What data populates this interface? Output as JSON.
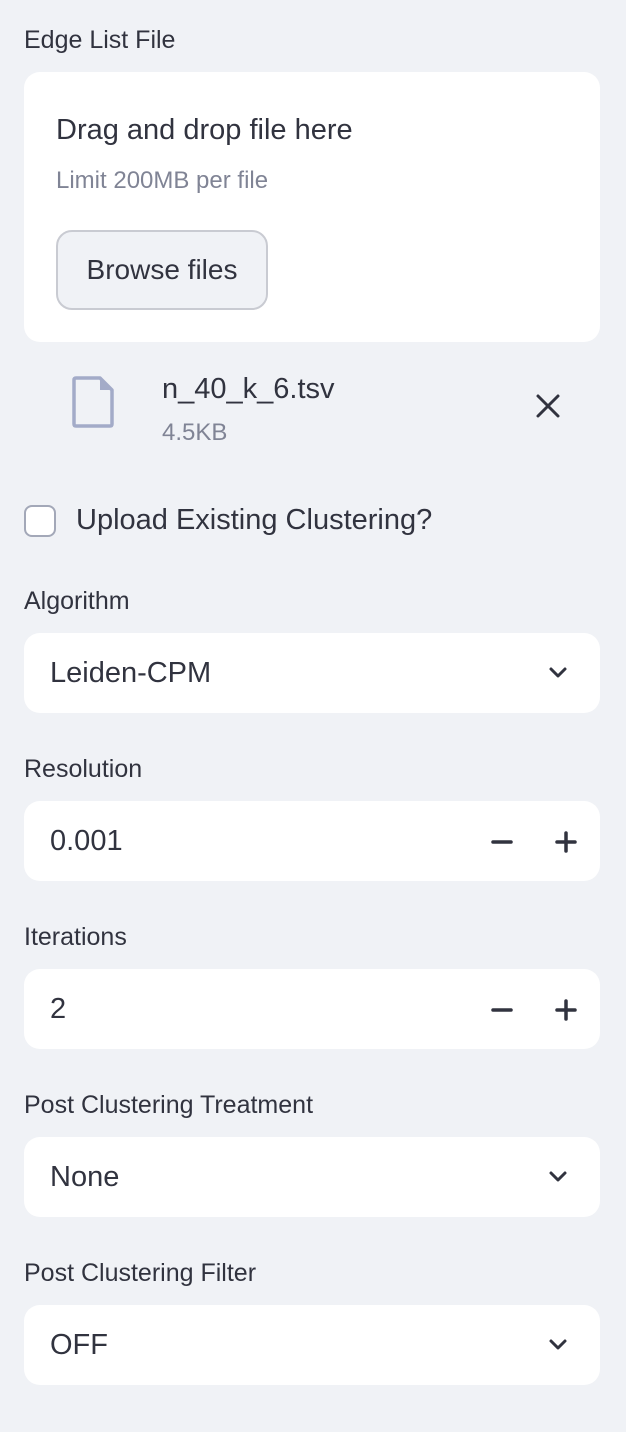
{
  "edge_list": {
    "label": "Edge List File",
    "dropzone_title": "Drag and drop file here",
    "dropzone_limit": "Limit 200MB per file",
    "browse_label": "Browse files",
    "file": {
      "name": "n_40_k_6.tsv",
      "size": "4.5KB",
      "icon": "file-icon"
    }
  },
  "upload_existing": {
    "label": "Upload Existing Clustering?",
    "checked": false
  },
  "algorithm": {
    "label": "Algorithm",
    "value": "Leiden-CPM"
  },
  "resolution": {
    "label": "Resolution",
    "value": "0.001"
  },
  "iterations": {
    "label": "Iterations",
    "value": "2"
  },
  "post_treatment": {
    "label": "Post Clustering Treatment",
    "value": "None"
  },
  "post_filter": {
    "label": "Post Clustering Filter",
    "value": "OFF"
  },
  "colors": {
    "background": "#f0f2f6",
    "surface": "#ffffff",
    "text": "#31333f",
    "muted_text": "#808495",
    "file_icon": "#a3abc8"
  }
}
